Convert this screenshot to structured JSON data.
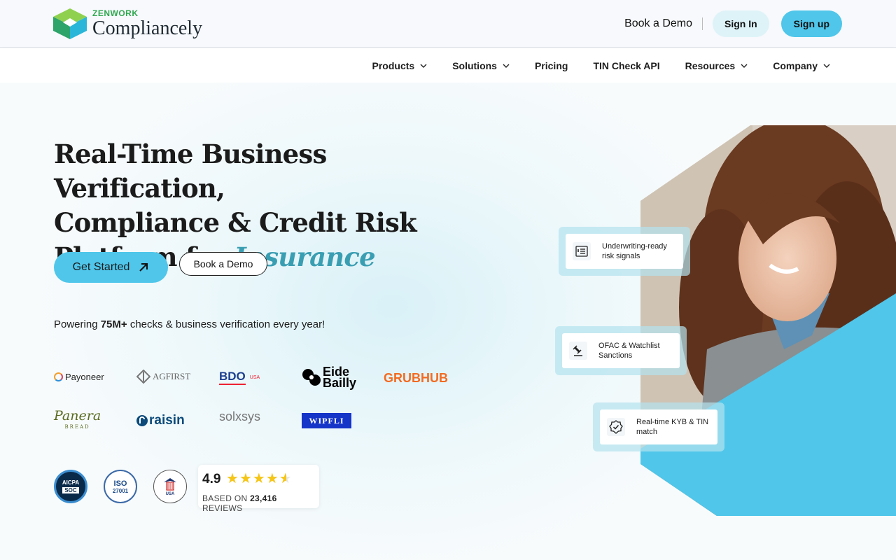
{
  "header": {
    "brand": "ZENWORK",
    "product": "Compliancely",
    "book_demo": "Book a Demo",
    "sign_in": "Sign In",
    "sign_up": "Sign up"
  },
  "nav": {
    "products": "Products",
    "solutions": "Solutions",
    "pricing": "Pricing",
    "tin_check": "TIN Check API",
    "resources": "Resources",
    "company": "Company"
  },
  "hero": {
    "headline_line1": "Real-Time Business Verification,",
    "headline_line2": "Compliance & Credit Risk",
    "headline_line3": "Platform for ",
    "headline_accent": "Insurance",
    "cta_primary": "Get Started",
    "cta_secondary": "Book a Demo",
    "powering_pre": "Powering ",
    "powering_bold": "75M+",
    "powering_post": " checks & business verification every year!"
  },
  "logos": {
    "payoneer": "Payoneer",
    "agfirst": "AGFIRST",
    "bdo": "BDO",
    "bdo_suffix": "USA",
    "eide_line1": "Eide",
    "eide_line2": "Bailly",
    "grubhub": "GRUBHUB",
    "panera": "Panera",
    "panera_sub": "BREAD",
    "raisin": "raisin",
    "solxsys": "solxsys",
    "wipfli": "WIPFLI"
  },
  "badges": {
    "aicpa": "AICPA",
    "aicpa_sub": "SOC",
    "iso": "ISO",
    "iso_sub": "27001",
    "ssa": "USA"
  },
  "rating": {
    "score": "4.9",
    "stars": 4.5,
    "based_on": "BASED ON ",
    "count": "23,416",
    "reviews": " REVIEWS"
  },
  "features": {
    "underwriting": "Underwriting-ready risk signals",
    "ofac": "OFAC & Watchlist Sanctions",
    "kyb": "Real-time KYB & TIN match"
  },
  "colors": {
    "accent": "#4fc6ea",
    "headline_accent": "#3a9eb2",
    "star": "#f5c518"
  }
}
